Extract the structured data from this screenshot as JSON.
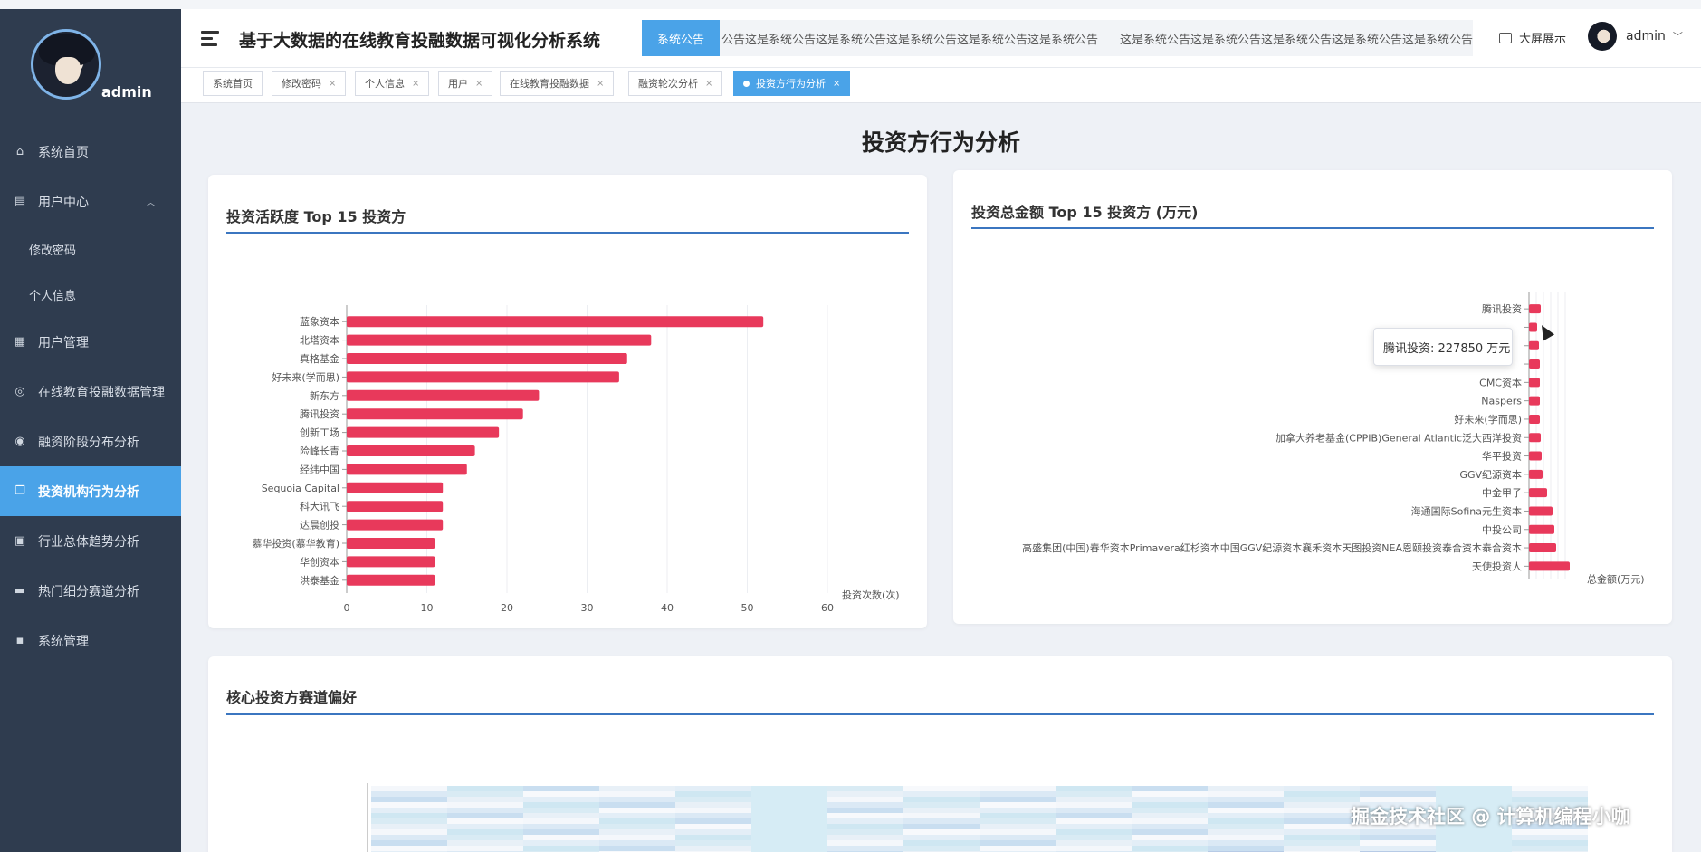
{
  "sidebar": {
    "username": "admin",
    "items": [
      {
        "label": "系统首页",
        "icon": "home-icon"
      },
      {
        "label": "用户中心",
        "icon": "user-center-icon"
      },
      {
        "label": "修改密码"
      },
      {
        "label": "个人信息"
      },
      {
        "label": "用户管理",
        "icon": "grid-icon"
      },
      {
        "label": "在线教育投融数据管理",
        "icon": "data-icon"
      },
      {
        "label": "融资阶段分布分析",
        "icon": "chart-icon"
      },
      {
        "label": "投资机构行为分析",
        "icon": "copy-icon"
      },
      {
        "label": "行业总体趋势分析",
        "icon": "clipboard-icon"
      },
      {
        "label": "热门细分赛道分析",
        "icon": "briefcase-icon"
      },
      {
        "label": "系统管理",
        "icon": "message-icon"
      }
    ]
  },
  "header": {
    "title": "基于大数据的在线教育投融数据可视化分析系统",
    "notice_label": "系统公告",
    "notice_text_1": "公告这是系统公告这是系统公告这是系统公告这是系统公告这是系统公告",
    "notice_text_2": "这是系统公告这是系统公告这是系统公告这是系统公告这是系统公告",
    "bigscreen": "大屏展示",
    "user": "admin"
  },
  "tabs": [
    {
      "label": "系统首页"
    },
    {
      "label": "修改密码"
    },
    {
      "label": "个人信息"
    },
    {
      "label": "用户"
    },
    {
      "label": "在线教育投融数据"
    },
    {
      "label": "融资轮次分析"
    },
    {
      "label": "投资方行为分析"
    }
  ],
  "page": {
    "title": "投资方行为分析"
  },
  "card1": {
    "title": "投资活跃度 Top 15 投资方"
  },
  "card2": {
    "title": "投资总金额 Top 15 投资方 (万元)"
  },
  "card3": {
    "title": "核心投资方赛道偏好"
  },
  "tooltip": "腾讯投资: 227850 万元",
  "watermark": "掘金技术社区 @ 计算机编程小咖",
  "chart_data": [
    {
      "type": "bar",
      "orientation": "horizontal",
      "categories": [
        "蓝象资本",
        "北塔资本",
        "真格基金",
        "好未来(学而思)",
        "新东方",
        "腾讯投资",
        "创新工场",
        "险峰长青",
        "经纬中国",
        "Sequoia Capital",
        "科大讯飞",
        "达晨创投",
        "慕华投资(慕华教育)",
        "华创资本",
        "洪泰基金"
      ],
      "values": [
        52,
        38,
        35,
        34,
        24,
        22,
        19,
        16,
        15,
        12,
        12,
        12,
        11,
        11,
        11
      ],
      "xlabel": "投资次数(次)",
      "xlim": [
        0,
        60
      ],
      "xticks": [
        0,
        10,
        20,
        30,
        40,
        50,
        60
      ],
      "color": "#e8395b",
      "grid": true
    },
    {
      "type": "bar",
      "orientation": "horizontal",
      "categories": [
        "腾讯投资",
        "",
        "",
        "",
        "CMC资本",
        "Naspers",
        "好未来(学而思)",
        "加拿大养老基金(CPPIB)General Atlantic泛大西洋投资",
        "华平投资",
        "GGV纪源资本",
        "中金甲子",
        "海通国际Sofina元生资本",
        "中投公司",
        "高盛集团(中国)春华资本Primavera红杉资本中国GGV纪源资本襄禾资本天图投资NEA恩颐投资泰合资本泰合资本",
        "天使投资人"
      ],
      "values": [
        227850,
        0,
        0,
        0,
        0,
        0,
        0,
        0,
        0,
        0,
        0,
        0,
        0,
        0,
        0
      ],
      "xlabel": "总金额(万元)",
      "color": "#e8395b"
    }
  ]
}
